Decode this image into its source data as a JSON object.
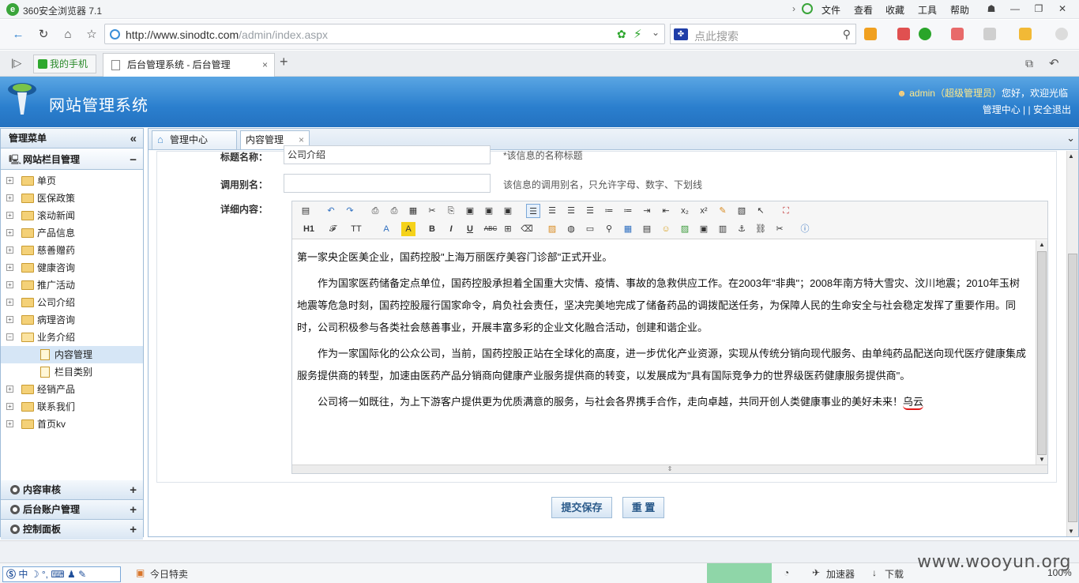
{
  "browser": {
    "title": "360安全浏览器 7.1",
    "menu": [
      "文件",
      "查看",
      "收藏",
      "工具",
      "帮助"
    ],
    "url_host": "http://www.sinodtc.com",
    "url_path": "/admin/index.aspx",
    "search_placeholder": "点此搜索",
    "tab_phone": "我的手机",
    "tab_active": "后台管理系统 - 后台管理"
  },
  "site": {
    "name": "网站管理系统",
    "user": "admin",
    "role": "超级管理员",
    "greet": "您好，欢迎光临",
    "link_center": "管理中心",
    "sep": "|",
    "link_logout": "安全退出"
  },
  "sidebar": {
    "title": "管理菜单",
    "section": "网站栏目管理",
    "items": [
      "单页",
      "医保政策",
      "滚动新闻",
      "产品信息",
      "慈善赠药",
      "健康咨询",
      "推广活动",
      "公司介绍",
      "病理咨询",
      "业务介绍"
    ],
    "subitems": [
      "内容管理",
      "栏目类别"
    ],
    "items_after": [
      "经销产品",
      "联系我们",
      "首页kv"
    ],
    "bottom": [
      "内容审核",
      "后台账户管理",
      "控制面板"
    ]
  },
  "content": {
    "tab_home": "管理中心",
    "tab_content": "内容管理",
    "label_title": "标题名称：",
    "title_value": "公司介绍",
    "title_hint": "*该信息的名称标题",
    "label_alias": "调用别名：",
    "alias_value": "",
    "alias_hint": "该信息的调用别名，只允许字母、数字、下划线",
    "label_detail": "详细内容：",
    "paragraphs": [
      "第一家央企医美企业，国药控股\"上海万丽医疗美容门诊部\"正式开业。",
      "作为国家医药储备定点单位，国药控股承担着全国重大灾情、疫情、事故的急救供应工作。在2003年\"非典\"；2008年南方特大雪灾、汶川地震；2010年玉树地震等危急时刻，国药控股履行国家命令，肩负社会责任，坚决完美地完成了储备药品的调拨配送任务，为保障人民的生命安全与社会稳定发挥了重要作用。同时，公司积极参与各类社会慈善事业，开展丰富多彩的企业文化融合活动，创建和谐企业。",
      "作为一家国际化的公众公司，当前，国药控股正站在全球化的高度，进一步优化产业资源，实现从传统分销向现代服务、由单纯药品配送向现代医疗健康集成服务提供商的转型，加速由医药产品分销商向健康产业服务提供商的转变，以发展成为\"具有国际竞争力的世界级医药健康服务提供商\"。",
      "公司将一如既往，为上下游客户提供更为优质满意的服务，与社会各界携手合作，走向卓越，共同开创人类健康事业的美好未来！"
    ],
    "signature": "乌云",
    "toolbar_row2": [
      "H1",
      "𝓕",
      "TT",
      "A",
      "A",
      "B",
      "I",
      "U",
      "ABC"
    ],
    "btn_submit": "提交保存",
    "btn_reset": "重 置"
  },
  "status": {
    "ime": "中",
    "today": "今日特卖",
    "accel": "加速器",
    "download": "下载",
    "zoom": "100%",
    "watermark": "www.wooyun.org"
  }
}
